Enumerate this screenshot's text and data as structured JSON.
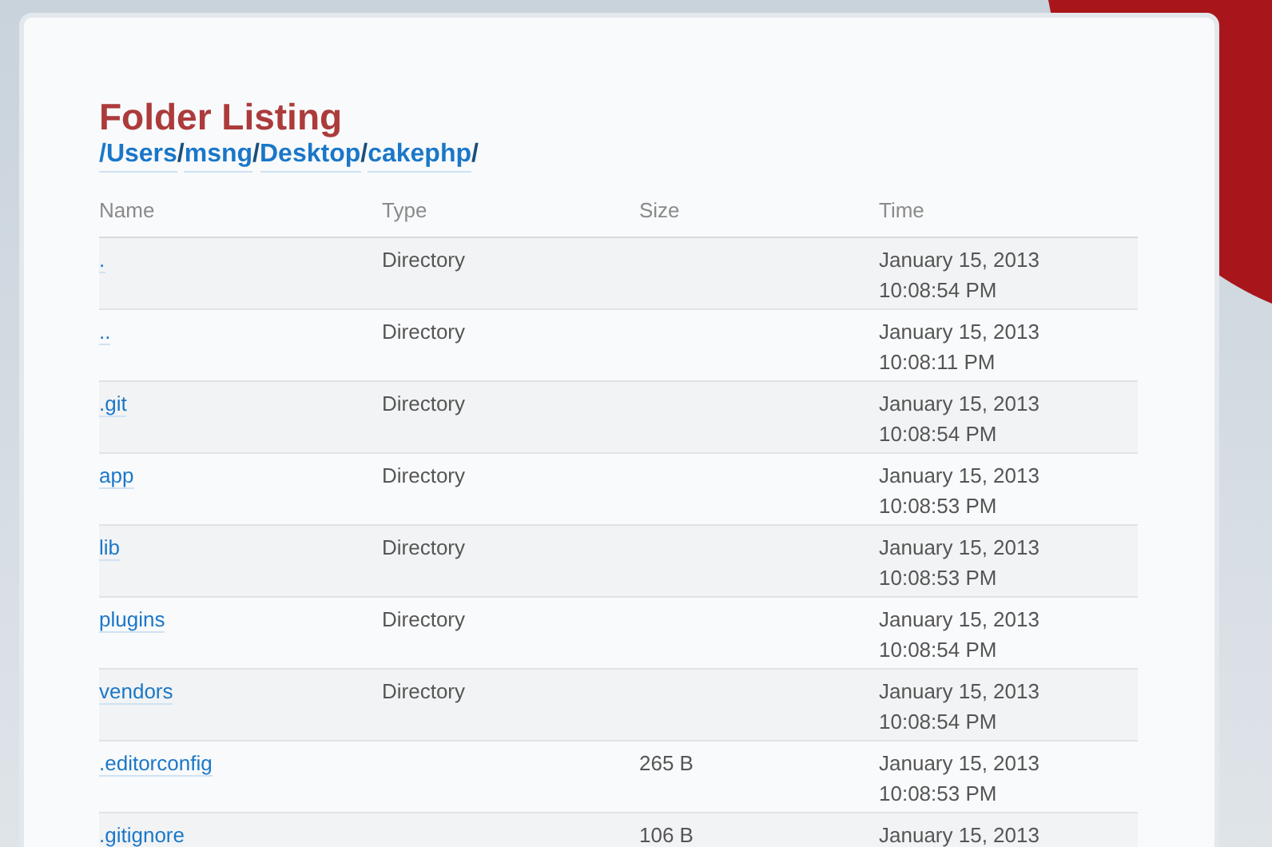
{
  "title": "Folder Listing",
  "path": [
    {
      "label": "/Users"
    },
    {
      "label": "/"
    },
    {
      "label": "msng"
    },
    {
      "label": "/"
    },
    {
      "label": "Desktop"
    },
    {
      "label": "/"
    },
    {
      "label": "cakephp"
    },
    {
      "label": "/"
    }
  ],
  "table": {
    "columns": [
      "Name",
      "Type",
      "Size",
      "Time"
    ],
    "rows": [
      {
        "name": ".",
        "type": "Directory",
        "date": "January 15, 2013",
        "time": "10:08:54 PM"
      },
      {
        "name": "..",
        "type": "Directory",
        "date": "January 15, 2013",
        "time": "10:08:11 PM"
      },
      {
        "name": ".git",
        "type": "Directory",
        "date": "January 15, 2013",
        "time": "10:08:54 PM"
      },
      {
        "name": "app",
        "type": "Directory",
        "date": "January 15, 2013",
        "time": "10:08:53 PM"
      },
      {
        "name": "lib",
        "type": "Directory",
        "date": "January 15, 2013",
        "time": "10:08:53 PM"
      },
      {
        "name": "plugins",
        "type": "Directory",
        "date": "January 15, 2013",
        "time": "10:08:54 PM"
      },
      {
        "name": "vendors",
        "type": "Directory",
        "date": "January 15, 2013",
        "time": "10:08:54 PM"
      },
      {
        "name": ".editorconfig",
        "size": "265 B",
        "date": "January 15, 2013",
        "time": "10:08:53 PM"
      },
      {
        "name": ".gitignore",
        "size": "106 B",
        "date": "January 15, 2013"
      }
    ]
  }
}
